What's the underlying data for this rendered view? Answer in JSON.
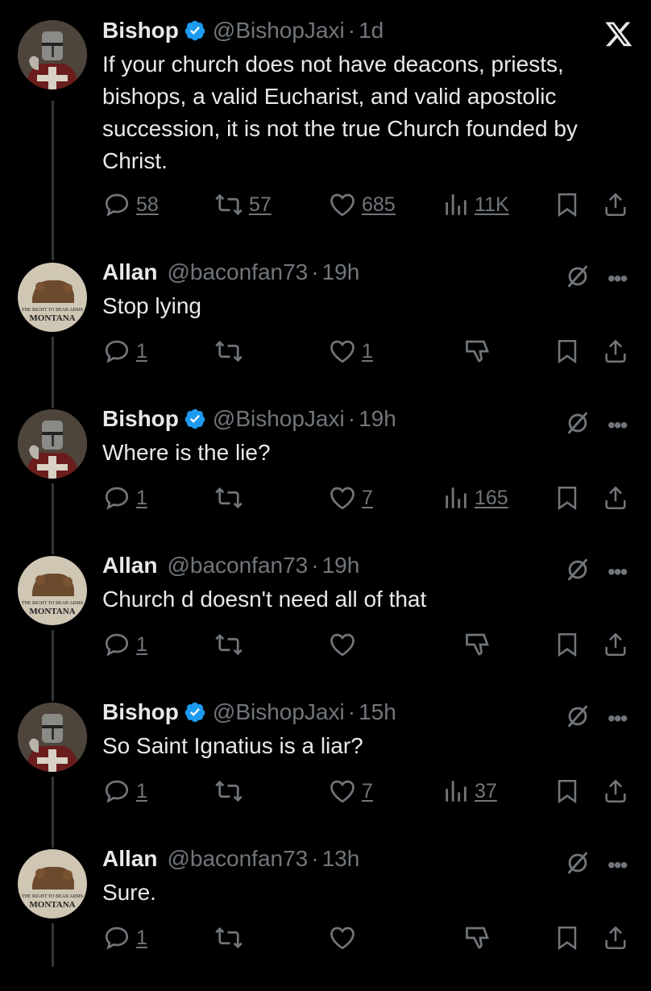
{
  "logo": "x-logo-icon",
  "colors": {
    "background": "#000000",
    "text": "#e7e9ea",
    "muted": "#71767b",
    "verified": "#1d9bf0",
    "thread_line": "#333639"
  },
  "tweets": [
    {
      "name": "Bishop",
      "handle": "@BishopJaxi",
      "sep": "·",
      "time": "1d",
      "text": "If your church does not have deacons, priests, bishops, a valid Eucharist, and valid apostolic succession, it is not the true Church founded by Christ.",
      "replies": "58",
      "retweets": "57",
      "likes": "685",
      "views": "11K"
    },
    {
      "name": "Allan",
      "handle": "@baconfan73",
      "sep": "·",
      "time": "19h",
      "text": "Stop lying",
      "replies": "1",
      "retweets": "",
      "likes": "1"
    },
    {
      "name": "Bishop",
      "handle": "@BishopJaxi",
      "sep": "·",
      "time": "19h",
      "text": "Where is the lie?",
      "replies": "1",
      "retweets": "",
      "likes": "7",
      "views": "165"
    },
    {
      "name": "Allan",
      "handle": "@baconfan73",
      "sep": "·",
      "time": "19h",
      "text": "Church d doesn't need all of that",
      "replies": "1",
      "retweets": "",
      "likes": ""
    },
    {
      "name": "Bishop",
      "handle": "@BishopJaxi",
      "sep": "·",
      "time": "15h",
      "text": "So Saint Ignatius is a liar?",
      "replies": "1",
      "retweets": "",
      "likes": "7",
      "views": "37"
    },
    {
      "name": "Allan",
      "handle": "@baconfan73",
      "sep": "·",
      "time": "13h",
      "text": "Sure.",
      "replies": "1",
      "retweets": "",
      "likes": ""
    }
  ],
  "avatar_text": {
    "line1": "THE RIGHT TO BEAR ARMS",
    "line2": "MONTANA"
  }
}
